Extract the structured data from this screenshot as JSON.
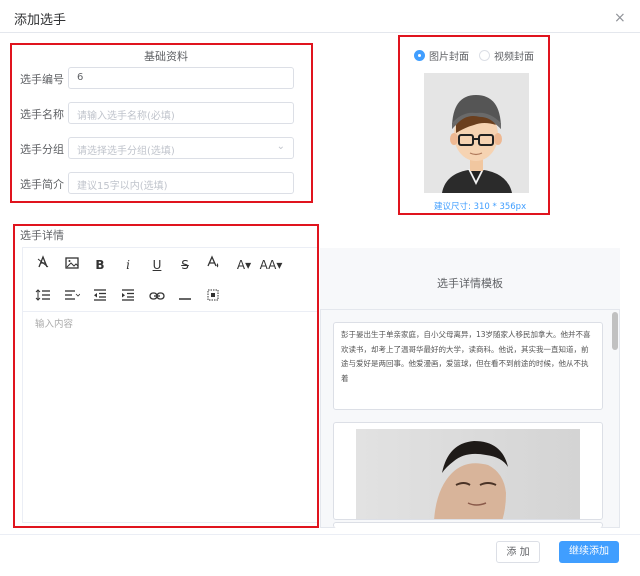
{
  "dialog": {
    "title": "添加选手",
    "close_label": "×"
  },
  "basic": {
    "heading": "基础资料",
    "fields": [
      {
        "label": "选手编号",
        "value": "6",
        "placeholder": ""
      },
      {
        "label": "选手名称",
        "value": "",
        "placeholder": "请输入选手名称(必填)"
      },
      {
        "label": "选手分组",
        "value": "",
        "placeholder": "请选择选手分组(选填)"
      },
      {
        "label": "选手简介",
        "value": "",
        "placeholder": "建议15字以内(选填)"
      }
    ]
  },
  "cover": {
    "options": [
      "图片封面",
      "视频封面"
    ],
    "selected": "图片封面",
    "size_hint": "建议尺寸: 310 * 356px"
  },
  "detail": {
    "heading": "选手详情",
    "toolbar": [
      "clear-format-icon",
      "image-icon",
      "B",
      "i",
      "U",
      "S",
      "fill-color-icon",
      "A▾",
      "AA▾",
      "line-height-icon",
      "align-icon",
      "outdent-icon",
      "indent-icon",
      "link-icon",
      "hr-icon",
      "table-icon"
    ],
    "placeholder": "输入内容"
  },
  "templates": {
    "heading": "选手详情模板",
    "text": "彭于晏出生于单亲家庭，自小父母离异，13岁随家人移民加拿大。他并不喜欢读书，却考上了温哥华最好的大学，读商科。他说，其实我一直知道，前途与爱好是两回事。他爱漫画，爱篮球，但在看不到前途的时候，他从不执着"
  },
  "footer": {
    "add_label": "添 加",
    "continue_label": "继续添加"
  },
  "colors": {
    "accent": "#409eff",
    "highlight": "#e0141e"
  }
}
